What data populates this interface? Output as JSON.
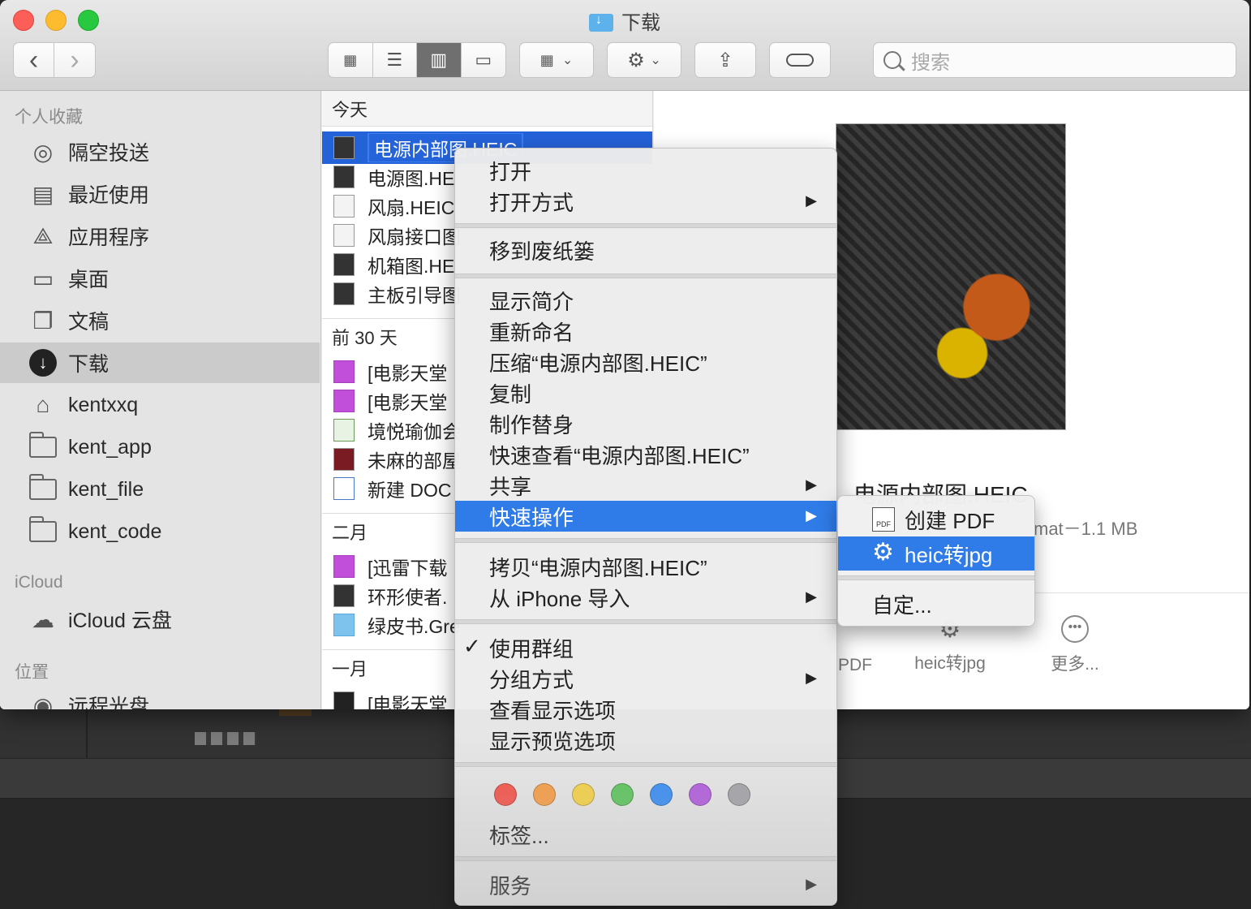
{
  "window": {
    "title": "下载"
  },
  "toolbar": {
    "back_icon": "‹",
    "forward_icon": "›",
    "view_icons": [
      "grid-view-icon",
      "list-view-icon",
      "column-view-icon",
      "gallery-view-icon"
    ],
    "search_placeholder": "搜索"
  },
  "sidebar": {
    "favorites_header": "个人收藏",
    "favorites": [
      {
        "label": "隔空投送",
        "icon": "airdrop-icon"
      },
      {
        "label": "最近使用",
        "icon": "recents-icon"
      },
      {
        "label": "应用程序",
        "icon": "applications-icon"
      },
      {
        "label": "桌面",
        "icon": "desktop-icon"
      },
      {
        "label": "文稿",
        "icon": "documents-icon"
      },
      {
        "label": "下载",
        "icon": "downloads-icon"
      },
      {
        "label": "kentxxq",
        "icon": "home-icon"
      },
      {
        "label": "kent_app",
        "icon": "folder-icon"
      },
      {
        "label": "kent_file",
        "icon": "folder-icon"
      },
      {
        "label": "kent_code",
        "icon": "folder-icon"
      }
    ],
    "icloud_header": "iCloud",
    "icloud_item": "iCloud 云盘",
    "locations_header": "位置",
    "locations_item": "远程光盘"
  },
  "column": {
    "groups": [
      {
        "header": "今天",
        "files": [
          "电源内部图.HEIC",
          "电源图.HE",
          "风扇.HEIC",
          "风扇接口图",
          "机箱图.HE",
          "主板引导图"
        ]
      },
      {
        "header": "前 30 天",
        "files": [
          "[电影天堂",
          "[电影天堂",
          "境悦瑜伽会",
          "未麻的部屋",
          "新建 DOC"
        ]
      },
      {
        "header": "二月",
        "files": [
          "[迅雷下载",
          "环形使者.",
          "绿皮书.Gre"
        ]
      },
      {
        "header": "一月",
        "files": [
          "[电影天堂"
        ]
      }
    ]
  },
  "preview": {
    "name": "电源内部图.HEIC",
    "meta": "mat－1.1 MB",
    "actions": [
      "PDF",
      "heic转jpg",
      "更多..."
    ]
  },
  "context_menu": {
    "items": [
      {
        "label": "打开"
      },
      {
        "label": "打开方式",
        "submenu": true
      },
      {
        "label": "移到废纸篓"
      },
      {
        "label": "显示简介"
      },
      {
        "label": "重新命名"
      },
      {
        "label": "压缩“电源内部图.HEIC”"
      },
      {
        "label": "复制"
      },
      {
        "label": "制作替身"
      },
      {
        "label": "快速查看“电源内部图.HEIC”"
      },
      {
        "label": "共享",
        "submenu": true
      },
      {
        "label": "快速操作",
        "submenu": true,
        "highlighted": true
      },
      {
        "label": "拷贝“电源内部图.HEIC”"
      },
      {
        "label": "从 iPhone 导入",
        "submenu": true
      },
      {
        "label": "使用群组",
        "checked": true
      },
      {
        "label": "分组方式",
        "submenu": true
      },
      {
        "label": "查看显示选项"
      },
      {
        "label": "显示预览选项"
      },
      {
        "label": "标签..."
      },
      {
        "label": "服务",
        "submenu": true
      }
    ],
    "tag_colors": [
      "#f4574d",
      "#f7a04a",
      "#f5d34b",
      "#60c660",
      "#3d8ff5",
      "#b460dd",
      "#a5a5aa"
    ]
  },
  "quick_actions_submenu": {
    "items": [
      {
        "label": "创建 PDF",
        "icon": "pdf-icon"
      },
      {
        "label": "heic转jpg",
        "icon": "gear-icon",
        "highlighted": true
      },
      {
        "label": "自定..."
      }
    ]
  }
}
